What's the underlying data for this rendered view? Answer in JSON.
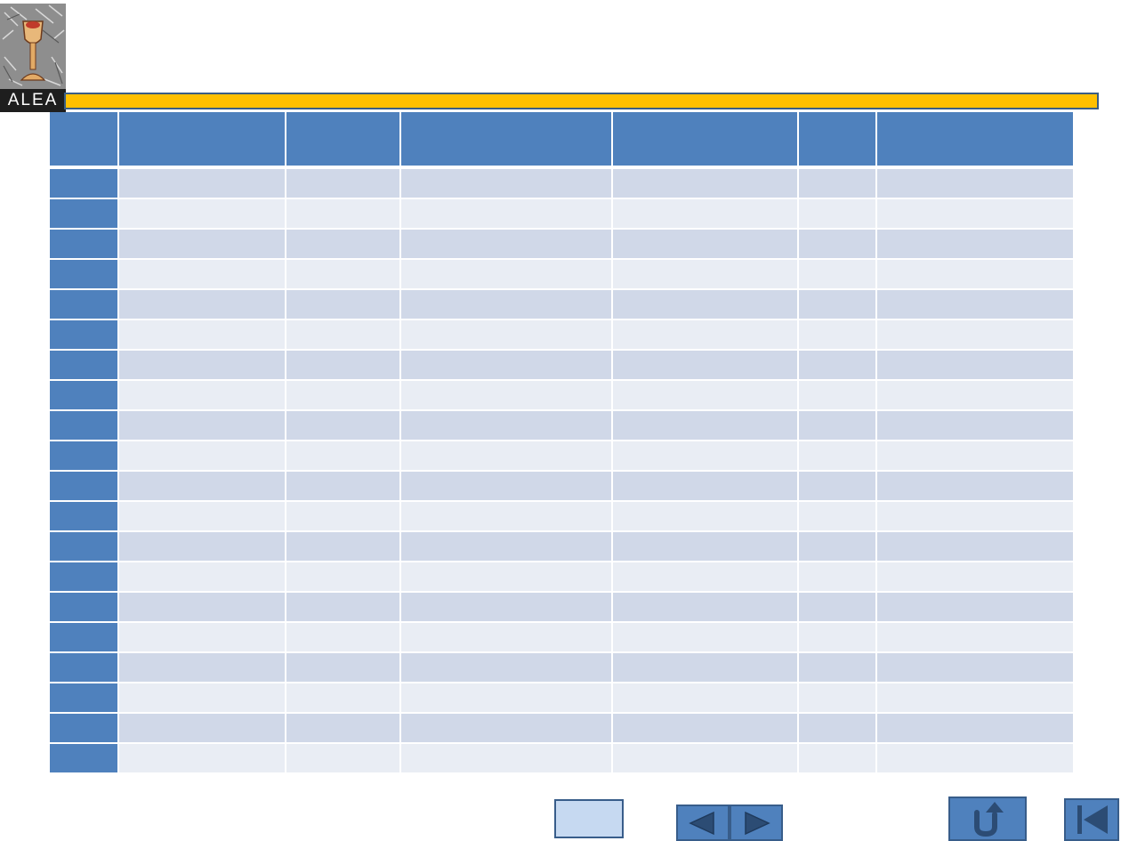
{
  "logo": {
    "text": "ALEA",
    "icon": "chalice-logo-icon"
  },
  "header_bar": {
    "color": "#ffc000",
    "border": "#3a5e84"
  },
  "table": {
    "header_color": "#4f81bd",
    "band_odd": "#d0d8e8",
    "band_even": "#e9edf4",
    "columns": [
      "",
      "",
      "",
      "",
      "",
      "",
      ""
    ],
    "rows": [
      [
        "",
        "",
        "",
        "",
        "",
        "",
        ""
      ],
      [
        "",
        "",
        "",
        "",
        "",
        "",
        ""
      ],
      [
        "",
        "",
        "",
        "",
        "",
        "",
        ""
      ],
      [
        "",
        "",
        "",
        "",
        "",
        "",
        ""
      ],
      [
        "",
        "",
        "",
        "",
        "",
        "",
        ""
      ],
      [
        "",
        "",
        "",
        "",
        "",
        "",
        ""
      ],
      [
        "",
        "",
        "",
        "",
        "",
        "",
        ""
      ],
      [
        "",
        "",
        "",
        "",
        "",
        "",
        ""
      ],
      [
        "",
        "",
        "",
        "",
        "",
        "",
        ""
      ],
      [
        "",
        "",
        "",
        "",
        "",
        "",
        ""
      ],
      [
        "",
        "",
        "",
        "",
        "",
        "",
        ""
      ],
      [
        "",
        "",
        "",
        "",
        "",
        "",
        ""
      ],
      [
        "",
        "",
        "",
        "",
        "",
        "",
        ""
      ],
      [
        "",
        "",
        "",
        "",
        "",
        "",
        ""
      ],
      [
        "",
        "",
        "",
        "",
        "",
        "",
        ""
      ],
      [
        "",
        "",
        "",
        "",
        "",
        "",
        ""
      ],
      [
        "",
        "",
        "",
        "",
        "",
        "",
        ""
      ],
      [
        "",
        "",
        "",
        "",
        "",
        "",
        ""
      ],
      [
        "",
        "",
        "",
        "",
        "",
        "",
        ""
      ],
      [
        "",
        "",
        "",
        "",
        "",
        "",
        ""
      ]
    ]
  },
  "nav": {
    "link_label": "",
    "prev_icon": "triangle-left-icon",
    "next_icon": "triangle-right-icon",
    "return_icon": "return-arrow-icon",
    "first_icon": "skip-to-start-icon",
    "button_color": "#4f81bd",
    "link_button_color": "#c6d9f1"
  }
}
